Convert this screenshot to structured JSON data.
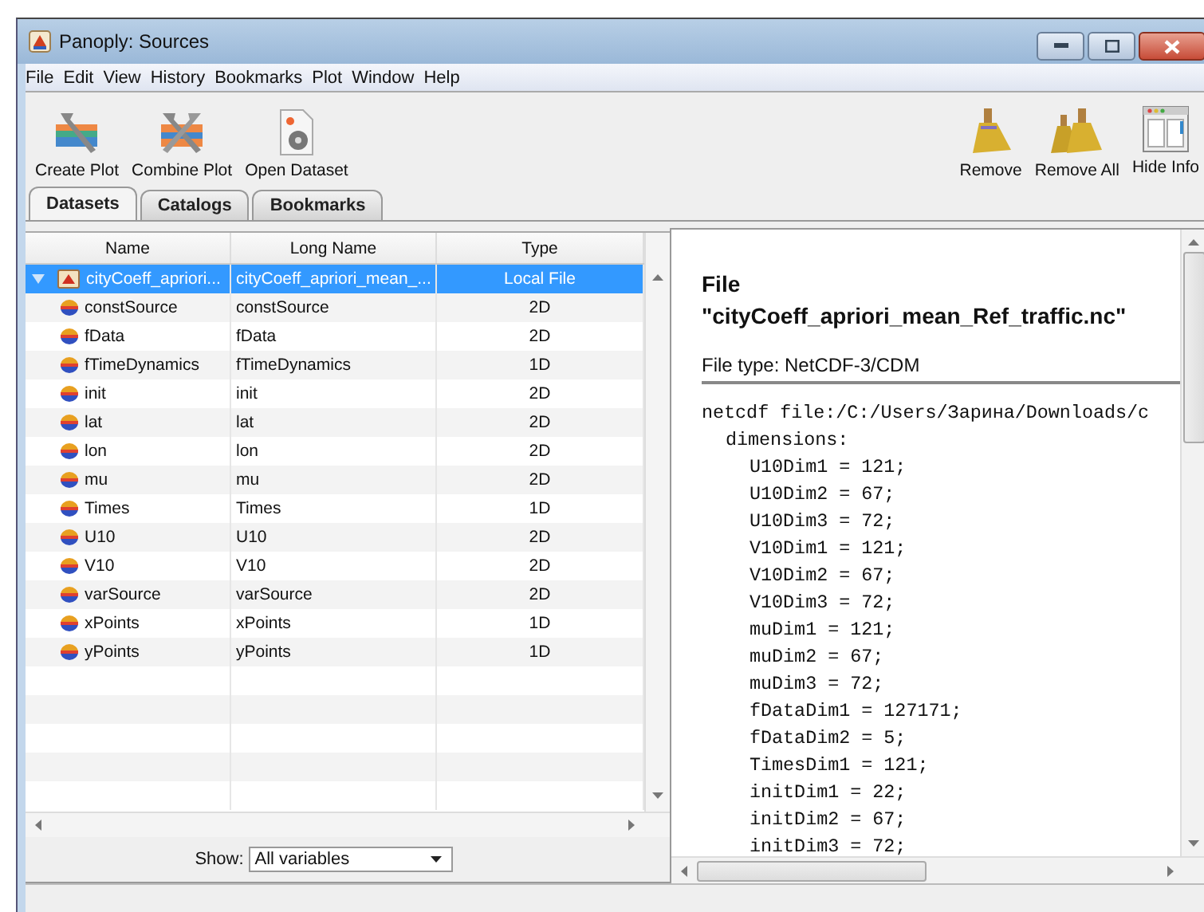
{
  "window": {
    "title": "Panoply: Sources"
  },
  "menu": [
    "File",
    "Edit",
    "View",
    "History",
    "Bookmarks",
    "Plot",
    "Window",
    "Help"
  ],
  "toolbar_left": [
    {
      "label": "Create Plot",
      "kind": "create"
    },
    {
      "label": "Combine Plot",
      "kind": "combine"
    },
    {
      "label": "Open Dataset",
      "kind": "open"
    }
  ],
  "toolbar_right": [
    {
      "label": "Remove",
      "kind": "broom"
    },
    {
      "label": "Remove All",
      "kind": "brooms"
    },
    {
      "label": "Hide Info",
      "kind": "info"
    }
  ],
  "tabs": [
    {
      "label": "Datasets",
      "selected": true
    },
    {
      "label": "Catalogs",
      "selected": false
    },
    {
      "label": "Bookmarks",
      "selected": false
    }
  ],
  "table": {
    "columns": [
      "Name",
      "Long Name",
      "Type"
    ],
    "rows": [
      {
        "name": "cityCoeff_apriori...",
        "long_name": "cityCoeff_apriori_mean_...",
        "type": "Local File",
        "kind": "file",
        "expanded": true,
        "selected": true,
        "children": [
          {
            "name": "constSource",
            "long_name": "constSource",
            "type": "2D",
            "kind": "variable",
            "selected": false
          },
          {
            "name": "fData",
            "long_name": "fData",
            "type": "2D",
            "kind": "variable",
            "selected": false
          },
          {
            "name": "fTimeDynamics",
            "long_name": "fTimeDynamics",
            "type": "1D",
            "kind": "variable",
            "selected": false
          },
          {
            "name": "init",
            "long_name": "init",
            "type": "2D",
            "kind": "variable",
            "selected": false
          },
          {
            "name": "lat",
            "long_name": "lat",
            "type": "2D",
            "kind": "variable",
            "selected": false
          },
          {
            "name": "lon",
            "long_name": "lon",
            "type": "2D",
            "kind": "variable",
            "selected": false
          },
          {
            "name": "mu",
            "long_name": "mu",
            "type": "2D",
            "kind": "variable",
            "selected": false
          },
          {
            "name": "Times",
            "long_name": "Times",
            "type": "1D",
            "kind": "variable",
            "selected": false
          },
          {
            "name": "U10",
            "long_name": "U10",
            "type": "2D",
            "kind": "variable",
            "selected": false
          },
          {
            "name": "V10",
            "long_name": "V10",
            "type": "2D",
            "kind": "variable",
            "selected": false
          },
          {
            "name": "varSource",
            "long_name": "varSource",
            "type": "2D",
            "kind": "variable",
            "selected": false
          },
          {
            "name": "xPoints",
            "long_name": "xPoints",
            "type": "1D",
            "kind": "variable",
            "selected": false
          },
          {
            "name": "yPoints",
            "long_name": "yPoints",
            "type": "1D",
            "kind": "variable",
            "selected": false
          }
        ]
      }
    ]
  },
  "show": {
    "label": "Show:",
    "value": "All variables"
  },
  "info": {
    "title": "File \"cityCoeff_apriori_mean_Ref_traffic.nc\"",
    "file_type": "File type: NetCDF-3/CDM",
    "listing": [
      {
        "text": "netcdf file:/C:/Users/Зарина/Downloads/c",
        "children": [
          {
            "text": "dimensions:",
            "children": [
              {
                "text": "U10Dim1 = 121;"
              },
              {
                "text": "U10Dim2 = 67;"
              },
              {
                "text": "U10Dim3 = 72;"
              },
              {
                "text": "V10Dim1 = 121;"
              },
              {
                "text": "V10Dim2 = 67;"
              },
              {
                "text": "V10Dim3 = 72;"
              },
              {
                "text": "muDim1 = 121;"
              },
              {
                "text": "muDim2 = 67;"
              },
              {
                "text": "muDim3 = 72;"
              },
              {
                "text": "fDataDim1 = 127171;"
              },
              {
                "text": "fDataDim2 = 5;"
              },
              {
                "text": "TimesDim1 = 121;"
              },
              {
                "text": "initDim1 = 22;"
              },
              {
                "text": "initDim2 = 67;"
              },
              {
                "text": "initDim3 = 72;"
              }
            ]
          }
        ]
      }
    ]
  }
}
